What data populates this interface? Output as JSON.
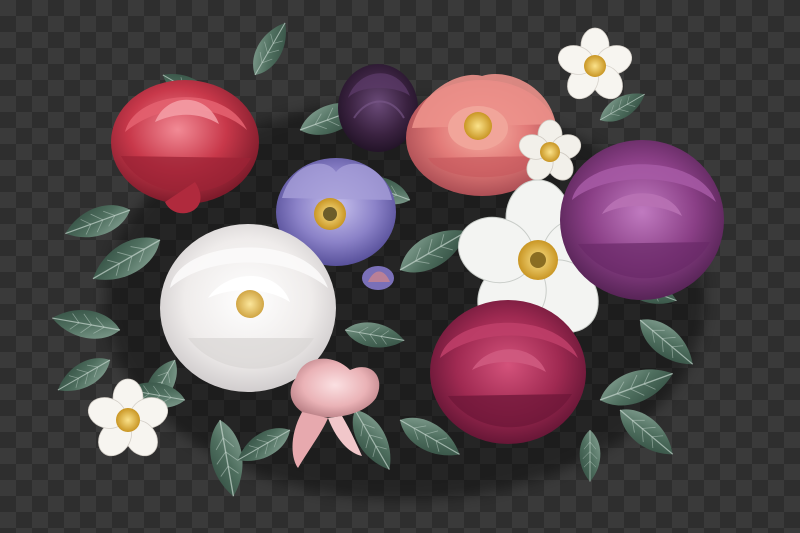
{
  "scene": {
    "kind": "botanical-illustration",
    "background": "transparency-checkerboard",
    "checker_colors": [
      "#2e2e2e",
      "#3a3a3a"
    ]
  },
  "palette": {
    "leaf_dark": "#2f4a3e",
    "leaf_mid": "#4f6f5f",
    "leaf_light": "#8aa698",
    "red_peony": "#c8384a",
    "coral_peony": "#e27a78",
    "plum": "#3a2240",
    "lilac": "#8b82c8",
    "white_rose": "#efeceb",
    "white_anemone": "#f3f4f2",
    "magenta_rose": "#a02a52",
    "purple_rose": "#8a3f86",
    "pink_bud": "#eab2b6",
    "daisy": "#f7f5f0",
    "stamen": "#e8c24a"
  },
  "flowers": [
    {
      "id": "red-peony",
      "color": "#c8384a"
    },
    {
      "id": "plum-bloom",
      "color": "#3a2240"
    },
    {
      "id": "coral-peony",
      "color": "#e27a78"
    },
    {
      "id": "top-daisy",
      "color": "#f7f5f0"
    },
    {
      "id": "small-daisy",
      "color": "#f2f0ea"
    },
    {
      "id": "lilac-anemone",
      "color": "#8b82c8"
    },
    {
      "id": "white-rose",
      "color": "#efeceb"
    },
    {
      "id": "white-anemone",
      "color": "#f3f4f2"
    },
    {
      "id": "purple-rose",
      "color": "#8a3f86"
    },
    {
      "id": "magenta-rose",
      "color": "#a02a52"
    },
    {
      "id": "pink-bud",
      "color": "#eab2b6"
    },
    {
      "id": "bottom-daisy",
      "color": "#f7f5f0"
    }
  ]
}
